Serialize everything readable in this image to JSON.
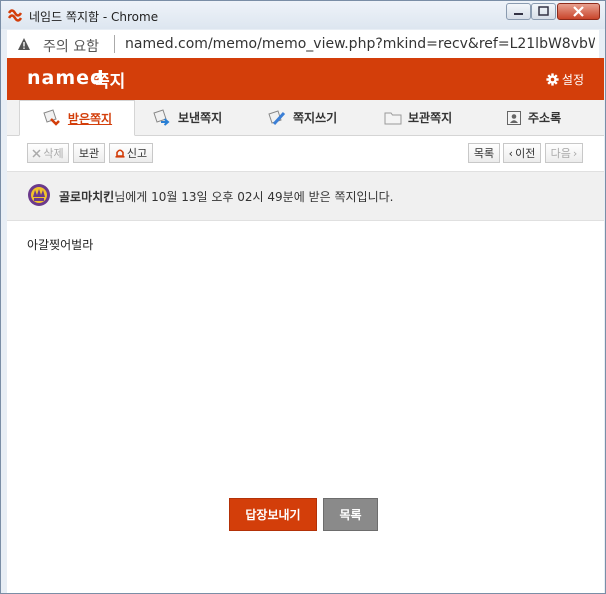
{
  "window": {
    "title": "네임드 쪽지함 - Chrome"
  },
  "address": {
    "security_label": "주의 요함",
    "url": "named.com/memo/memo_view.php?mkind=recv&ref=L21lbW8vbWVtb1..."
  },
  "header": {
    "logo": "named",
    "title": "쪽지",
    "settings_label": "설정"
  },
  "tabs": [
    {
      "label": "받은쪽지",
      "icon": "inbox-icon",
      "active": true
    },
    {
      "label": "보낸쪽지",
      "icon": "sent-icon",
      "active": false
    },
    {
      "label": "쪽지쓰기",
      "icon": "compose-icon",
      "active": false
    },
    {
      "label": "보관쪽지",
      "icon": "folder-icon",
      "active": false
    },
    {
      "label": "주소록",
      "icon": "addressbook-icon",
      "active": false
    }
  ],
  "toolbar": {
    "delete_label": "삭제",
    "keep_label": "보관",
    "report_label": "신고",
    "list_label": "목록",
    "prev_label": "이전",
    "next_label": "다음"
  },
  "message": {
    "sender": "골로마치킨",
    "info_text": "님에게 10월 13일 오후 02시 49분에 받은 쪽지입니다.",
    "body": "아갈찢어벌라"
  },
  "actions": {
    "reply_label": "답장보내기",
    "list_label": "목록"
  },
  "colors": {
    "brand": "#d33e0a"
  }
}
